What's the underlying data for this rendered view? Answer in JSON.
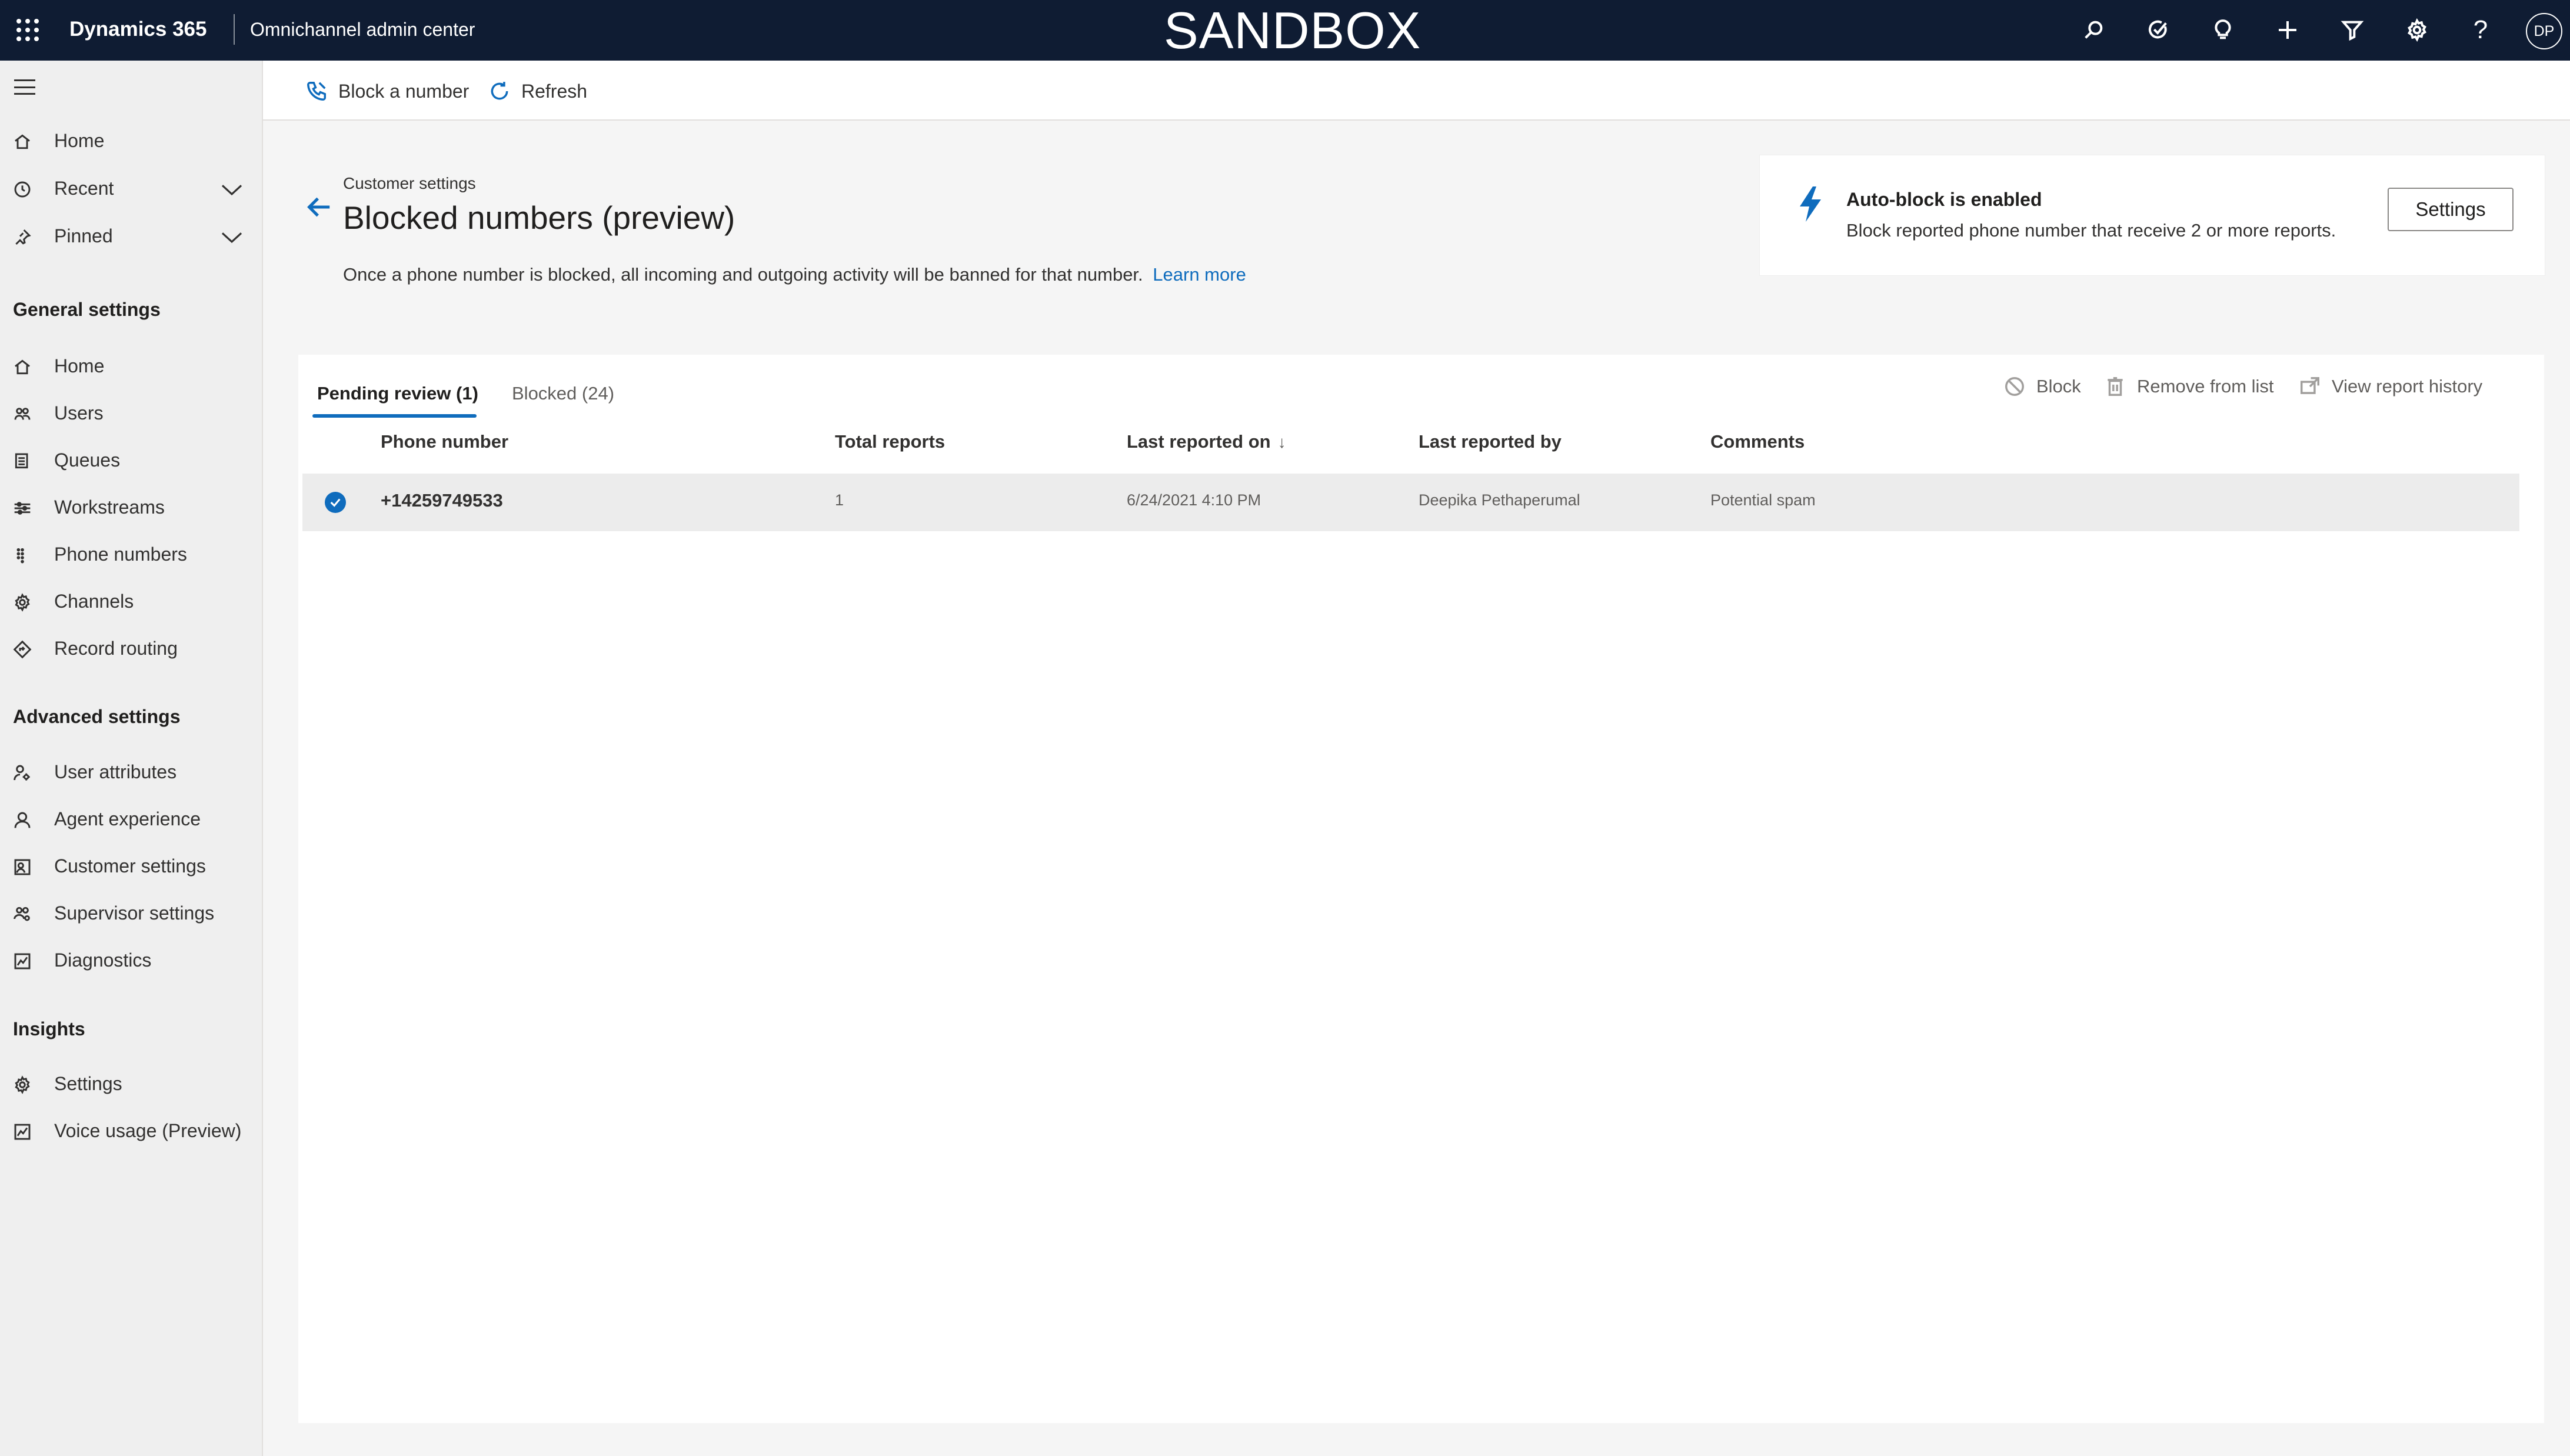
{
  "header": {
    "brand": "Dynamics 365",
    "app_name": "Omnichannel admin center",
    "environment_label": "SANDBOX",
    "avatar_initials": "DP",
    "icons": [
      "search-icon",
      "task-icon",
      "lightbulb-icon",
      "plus-icon",
      "filter-icon",
      "gear-icon",
      "help-icon"
    ]
  },
  "sidebar": {
    "top_items": [
      {
        "label": "Home",
        "icon": "home-icon"
      },
      {
        "label": "Recent",
        "icon": "clock-icon"
      },
      {
        "label": "Pinned",
        "icon": "pin-icon"
      }
    ],
    "general_heading": "General settings",
    "general_items": [
      {
        "label": "Home",
        "icon": "home-icon"
      },
      {
        "label": "Users",
        "icon": "users-icon"
      },
      {
        "label": "Queues",
        "icon": "queues-icon"
      },
      {
        "label": "Workstreams",
        "icon": "workstreams-icon"
      },
      {
        "label": "Phone numbers",
        "icon": "dialpad-icon"
      },
      {
        "label": "Channels",
        "icon": "channels-icon"
      },
      {
        "label": "Record routing",
        "icon": "routing-icon"
      }
    ],
    "advanced_heading": "Advanced settings",
    "advanced_items": [
      {
        "label": "User attributes",
        "icon": "user-attributes-icon"
      },
      {
        "label": "Agent experience",
        "icon": "agent-icon"
      },
      {
        "label": "Customer settings",
        "icon": "customer-settings-icon"
      },
      {
        "label": "Supervisor settings",
        "icon": "supervisor-icon"
      },
      {
        "label": "Diagnostics",
        "icon": "diagnostics-icon"
      }
    ],
    "insights_heading": "Insights",
    "insights_items": [
      {
        "label": "Settings",
        "icon": "gear-icon"
      },
      {
        "label": "Voice usage (Preview)",
        "icon": "chart-icon"
      }
    ]
  },
  "command_bar": {
    "block_label": "Block a number",
    "refresh_label": "Refresh"
  },
  "page": {
    "breadcrumb": "Customer settings",
    "title": "Blocked numbers (preview)",
    "description": "Once a phone number is blocked, all incoming and outgoing activity will be banned for that number.",
    "learn_more": "Learn more"
  },
  "autoblock": {
    "title": "Auto-block is enabled",
    "description": "Block reported phone number that receive 2 or more reports.",
    "settings_label": "Settings",
    "accent_color": "#0f6cbd"
  },
  "tabs": [
    {
      "label": "Pending review (1)",
      "active": true
    },
    {
      "label": "Blocked (24)",
      "active": false
    }
  ],
  "actions": {
    "block": "Block",
    "remove": "Remove from list",
    "history": "View report history"
  },
  "table": {
    "columns": [
      "Phone number",
      "Total reports",
      "Last reported on",
      "Last reported by",
      "Comments"
    ],
    "sort_indicator": "↓",
    "rows": [
      {
        "selected": true,
        "phone": "+14259749533",
        "total_reports": "1",
        "last_reported_on": "6/24/2021 4:10 PM",
        "last_reported_by": "Deepika Pethaperumal",
        "comments": "Potential spam"
      }
    ]
  }
}
